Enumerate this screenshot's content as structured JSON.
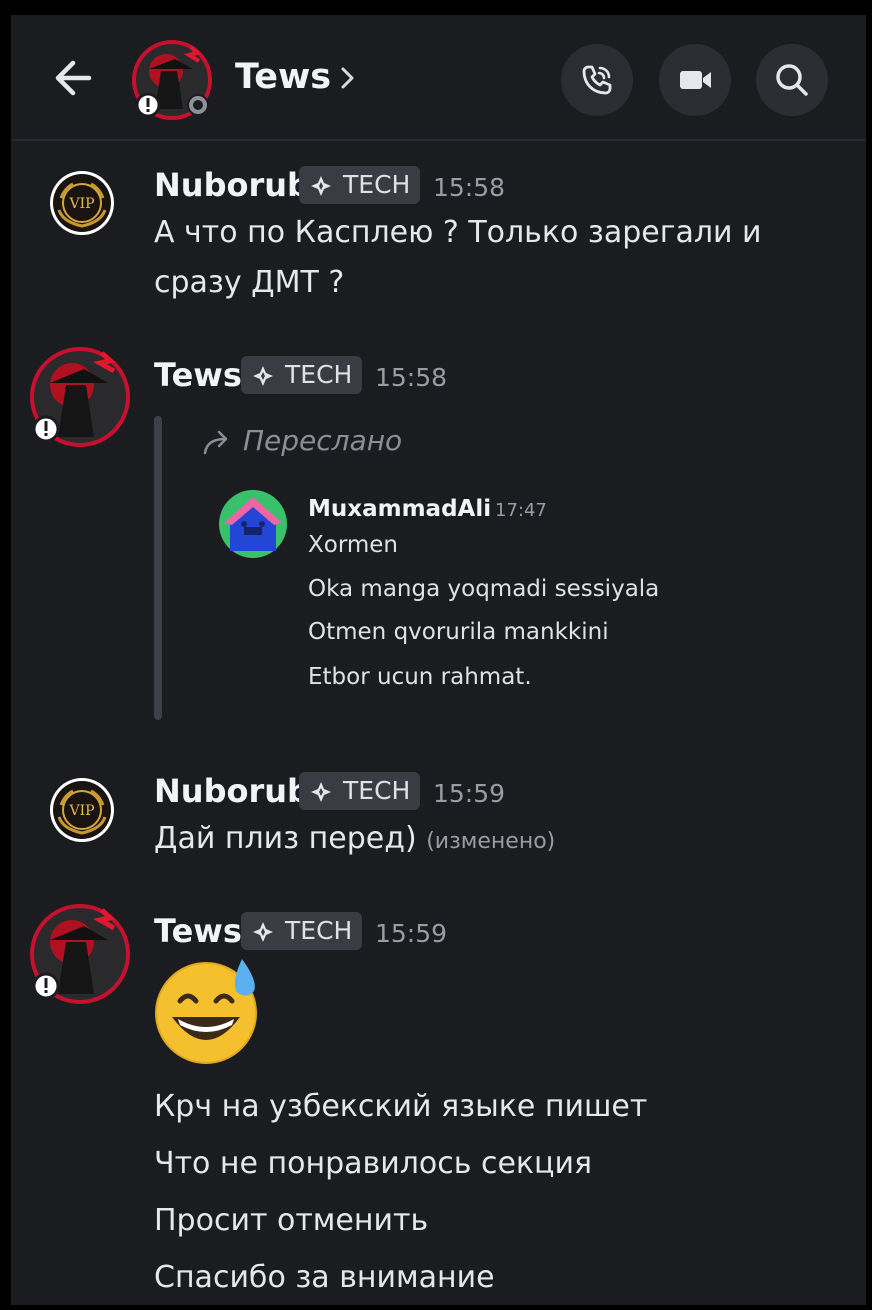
{
  "header": {
    "title": "Tews",
    "back_icon": "arrow-left-icon",
    "chevron_icon": "chevron-right-icon",
    "call_icon": "phone-icon",
    "video_icon": "video-camera-icon",
    "search_icon": "search-icon"
  },
  "colors": {
    "background": "#1b1c20",
    "text": "#e6e7ea",
    "muted": "#9a9ca3",
    "tag_bg": "#3a3c43"
  },
  "messages": [
    {
      "author": "Nuborub",
      "tag": "TECH",
      "time": "15:58",
      "lines": [
        "А что по Касплею ? Только зарегали и",
        "сразу ДМТ ?"
      ]
    },
    {
      "author": "Tews",
      "tag": "TECH",
      "time": "15:58",
      "forwarded_label": "Переслано",
      "forwarded": {
        "author": "MuxammadAli",
        "time": "17:47",
        "lines": [
          "Xormen",
          "Oka manga yoqmadi sessiyala",
          "Otmen qvorurila mankkini",
          "Etbor ucun rahmat."
        ]
      }
    },
    {
      "author": "Nuborub",
      "tag": "TECH",
      "time": "15:59",
      "text": "Дай плиз перед)",
      "edited": "(изменено)"
    },
    {
      "author": "Tews",
      "tag": "TECH",
      "time": "15:59",
      "emoji": "grinning-face-with-sweat-icon",
      "lines": [
        "Крч на узбекский языке пишет",
        "Что не понравилось секция",
        "Просит отменить",
        "Спасибо за внимание"
      ]
    }
  ]
}
